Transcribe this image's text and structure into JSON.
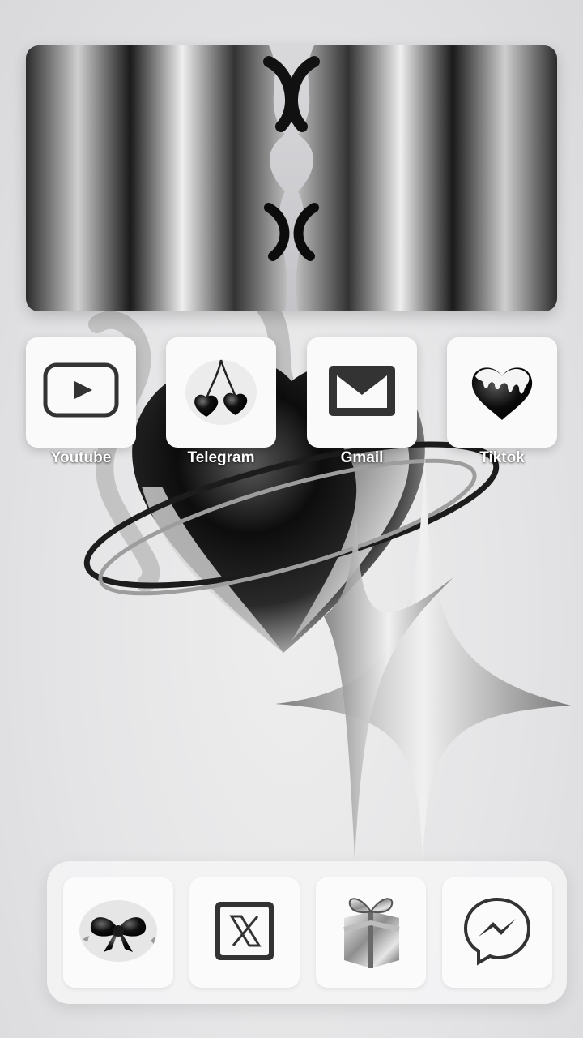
{
  "home_screen": {
    "apps": [
      {
        "label": "Youtube",
        "icon": "youtube-play-icon"
      },
      {
        "label": "Telegram",
        "icon": "cherry-hearts-icon"
      },
      {
        "label": "Gmail",
        "icon": "mail-envelope-icon"
      },
      {
        "label": "Tiktok",
        "icon": "dripping-heart-icon"
      }
    ],
    "dock": [
      {
        "icon": "bow-ribbon-icon"
      },
      {
        "icon": "x-logo-icon"
      },
      {
        "icon": "gift-box-icon"
      },
      {
        "icon": "messenger-icon"
      }
    ]
  },
  "widget": {
    "type": "photo",
    "icon": "chrome-faces-image"
  },
  "colors": {
    "chrome_dark": "#1a1a1a",
    "chrome_light": "#e8e8ea",
    "tile": "#fafafa",
    "label": "#ffffff"
  }
}
